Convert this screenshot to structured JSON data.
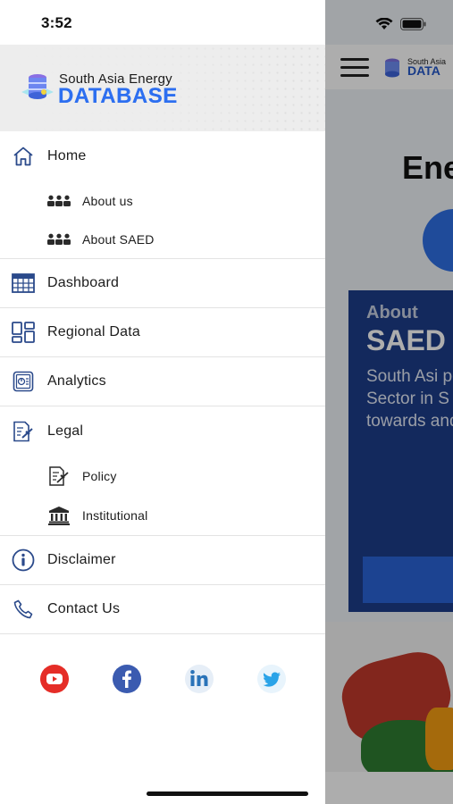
{
  "status_bar": {
    "time": "3:52"
  },
  "brand": {
    "line1": "South Asia Energy",
    "line2": "DATABASE"
  },
  "nav": {
    "home": "Home",
    "about_us": "About us",
    "about_saed": "About SAED",
    "dashboard": "Dashboard",
    "regional_data": "Regional Data",
    "analytics": "Analytics",
    "legal": "Legal",
    "policy": "Policy",
    "institutional": "Institutional",
    "disclaimer": "Disclaimer",
    "contact_us": "Contact Us"
  },
  "social": [
    "youtube-icon",
    "facebook-icon",
    "linkedin-icon",
    "twitter-icon"
  ],
  "background": {
    "logo_line1": "South Asia",
    "logo_line2": "DATA",
    "heading": "Ene",
    "card_small": "About",
    "card_big": "SAED",
    "card_text": "South Asi point plat informati Sector in S It acts as reduce d towards and analy"
  },
  "colors": {
    "brand_blue": "#2d6ff0",
    "nav_icon": "#2b4a8b",
    "youtube": "#e52d27",
    "facebook": "#3b5bb0",
    "linkedin": "#2a73b8",
    "twitter": "#2aa3e8"
  }
}
